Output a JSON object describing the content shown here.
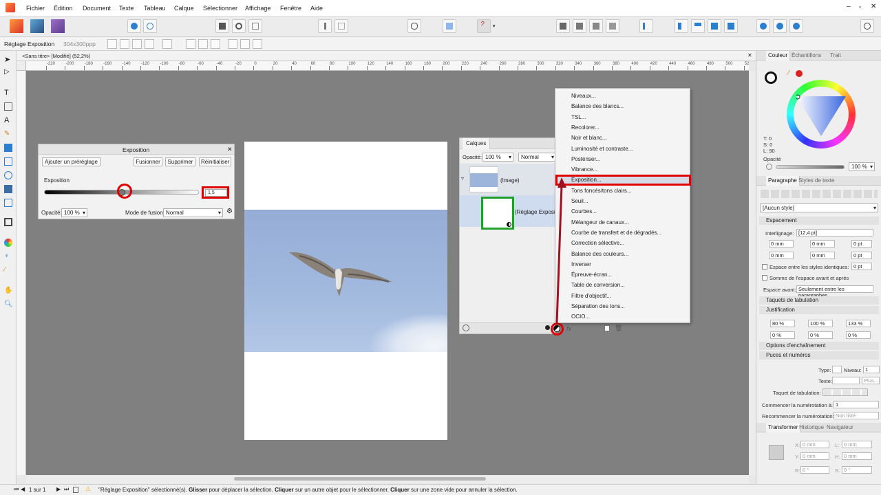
{
  "menubar": {
    "items": [
      "Fichier",
      "Édition",
      "Document",
      "Texte",
      "Tableau",
      "Calque",
      "Sélectionner",
      "Affichage",
      "Fenêtre",
      "Aide"
    ]
  },
  "context": {
    "label": "Réglage Exposition",
    "resolution": "304x300ppp"
  },
  "doc_tab": {
    "title": "<Sans titre> [Modifié] (52,2%)",
    "close": "✕"
  },
  "ruler": {
    "ticks": [
      "-220",
      "-200",
      "-180",
      "-160",
      "-140",
      "-120",
      "-100",
      "-80",
      "-60",
      "-40",
      "-20",
      "0",
      "20",
      "40",
      "60",
      "80",
      "100",
      "120",
      "140",
      "160",
      "180",
      "200",
      "220",
      "240",
      "260",
      "280",
      "300",
      "320",
      "340",
      "360",
      "380",
      "400",
      "420",
      "440",
      "460",
      "480",
      "500",
      "52"
    ]
  },
  "exposure_dialog": {
    "title": "Exposition",
    "close": "✕",
    "add_preset": "Ajouter un préréglage",
    "merge": "Fusionner",
    "delete": "Supprimer",
    "reset": "Réinitialiser",
    "param_label": "Exposition",
    "value": "1,5",
    "slider_level": 0.5,
    "opacity_label": "Opacité:",
    "opacity_value": "100 %",
    "blend_label": "Mode de fusion:",
    "blend_value": "Normal"
  },
  "layers_panel": {
    "tab": "Calques",
    "opacity_label": "Opacité:",
    "opacity_value": "100 %",
    "blend": "Normal",
    "layer_image": "(Image)",
    "layer_adjust": "(Réglage Expositi"
  },
  "adjust_menu": {
    "items": [
      "Niveaux...",
      "Balance des blancs...",
      "TSL...",
      "Recolorer...",
      "Noir et blanc...",
      "Luminosité et contraste...",
      "Postériser...",
      "Vibrance...",
      "Exposition...",
      "Tons foncés/tons clairs...",
      "Seuil...",
      "Courbes...",
      "Mélangeur de canaux...",
      "Courbe de transfert et de dégradés...",
      "Correction sélective...",
      "Balance des couleurs...",
      "Inverser",
      "Épreuve-écran...",
      "Table de conversion...",
      "Filtre d'objectif...",
      "Séparation des tons...",
      "OCIO..."
    ],
    "highlighted_index": 8
  },
  "color_panel": {
    "tabs": [
      "Couleur",
      "Échantillons",
      "Trait"
    ],
    "t": "T: 0",
    "s": "S: 0",
    "l": "L: 90",
    "opacity_label": "Opacité",
    "opacity_value": "100 %"
  },
  "paragraph_panel": {
    "tabs": [
      "Paragraphe",
      "Styles de texte"
    ],
    "style": "[Aucun style]",
    "spacing_section": "Espacement",
    "interlignage_label": "Interlignage:",
    "interlignage_value": "[12,4 pt]",
    "f1": "0 mm",
    "f2": "0 mm",
    "f3": "0 pt",
    "f4": "0 mm",
    "f5": "0 mm",
    "f6": "0 pt",
    "espace_identiques": "Espace entre les styles identiques:",
    "espace_identiques_val": "0 pt",
    "somme": "Somme de l'espace avant et après",
    "espace_avant_label": "Espace avant:",
    "espace_avant_value": "Seulement entre les paragraphes",
    "taquets": "Taquets de tabulation",
    "justification": "Justification",
    "j1": "80 %",
    "j2": "100 %",
    "j3": "133 %",
    "j4": "0 %",
    "j5": "0 %",
    "j6": "0 %",
    "options": "Options d'enchaînement",
    "puces": "Puces et numéros",
    "type_label": "Type:",
    "niveau_label": "Niveau:",
    "niveau_value": "1",
    "texte_label": "Texte:",
    "plus": "Plus...",
    "taquet_label": "Taquet de tabulation:",
    "commencer_label": "Commencer la numérotation à:",
    "commencer_value": "1",
    "recommencer_label": "Recommencer la numérotation:",
    "recommencer_value": "Non listé"
  },
  "transform_panel": {
    "tabs": [
      "Transformer",
      "Historique",
      "Navigateur"
    ],
    "x": "X:",
    "x_val": "0 mm",
    "y": "Y:",
    "y_val": "0 mm",
    "w": "L:",
    "w_val": "0 mm",
    "h": "H:",
    "h_val": "0 mm",
    "r": "R:",
    "r_val": "0 °",
    "s": "S:",
    "s_val": "0 °"
  },
  "status": {
    "page": "1 sur 1",
    "message_pre": "\"Réglage Exposition\" sélectionné(s). ",
    "b1": "Glisser",
    "m1": " pour déplacer la sélection. ",
    "b2": "Cliquer",
    "m2": " sur un autre objet pour le sélectionner. ",
    "b3": "Cliquer",
    "m3": " sur une zone vide pour annuler la sélection."
  },
  "colors": {
    "highlight": "#e00000",
    "green": "#1fa028",
    "arrow": "#a01020"
  }
}
